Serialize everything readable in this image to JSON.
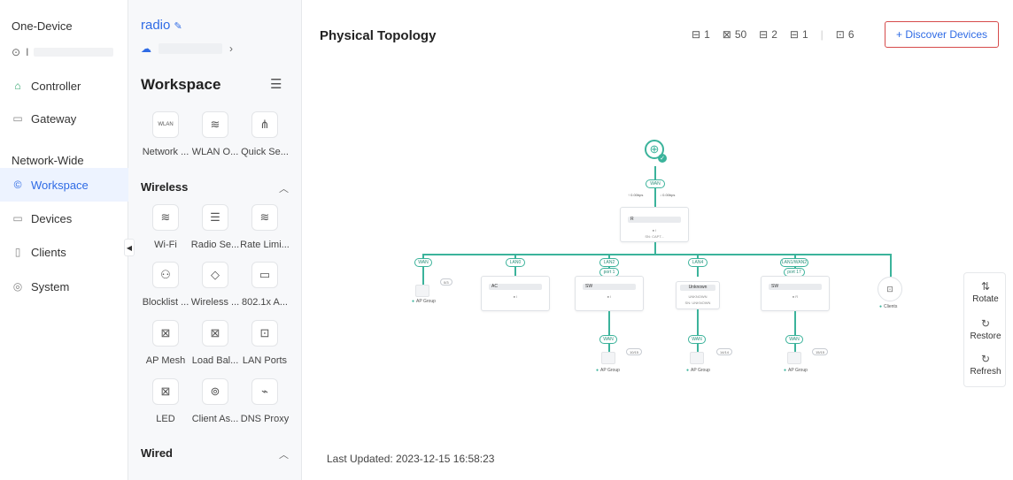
{
  "nav": {
    "site_name": "One-Device",
    "site_sub": "I",
    "controller": "Controller",
    "gateway": "Gateway",
    "section": "Network-Wide",
    "workspace": "Workspace",
    "devices": "Devices",
    "clients": "Clients",
    "system": "System"
  },
  "ws": {
    "device_name": "radio",
    "header": "Workspace",
    "top_tiles": [
      "Network ...",
      "WLAN O...",
      "Quick Se..."
    ],
    "wireless_title": "Wireless",
    "wireless_tiles": [
      "Wi-Fi",
      "Radio Se...",
      "Rate Limi...",
      "Blocklist ...",
      "Wireless ...",
      "802.1x A...",
      "AP Mesh",
      "Load Bal...",
      "LAN Ports",
      "LED",
      "Client As...",
      "DNS Proxy"
    ],
    "wired_title": "Wired"
  },
  "main": {
    "title": "Physical Topology",
    "counts": {
      "gateway": "1",
      "ap": "50",
      "switch": "2",
      "ac": "1",
      "clients": "6"
    },
    "discover_label": "+ Discover Devices",
    "last_updated": "Last Updated: 2023-12-15 16:58:23"
  },
  "tools": {
    "rotate": "Rotate",
    "restore": "Restore",
    "refresh": "Refresh"
  },
  "topology": {
    "wan_label": "WAN",
    "up_rate": "↑ 0.00bps",
    "down_rate": "↓ 0.00bps",
    "gateway_sn": "SN: CAPT...",
    "ports": [
      "WAN",
      "LAN0",
      "LAN2",
      "LAN4",
      "LAN1/WAN2"
    ],
    "subports": [
      "port 1",
      "port 17"
    ],
    "ac_label": "AC",
    "sw_label": "SW",
    "unknown_label": "Unknown",
    "unknown_status": "UNKNOWN",
    "unknown_sn": "SN: UNKNOWN",
    "ap_group": "AP Group",
    "clients_label": "Clients",
    "ap_counts": [
      "0/3",
      "10/15",
      "14/14",
      "15/15"
    ]
  }
}
